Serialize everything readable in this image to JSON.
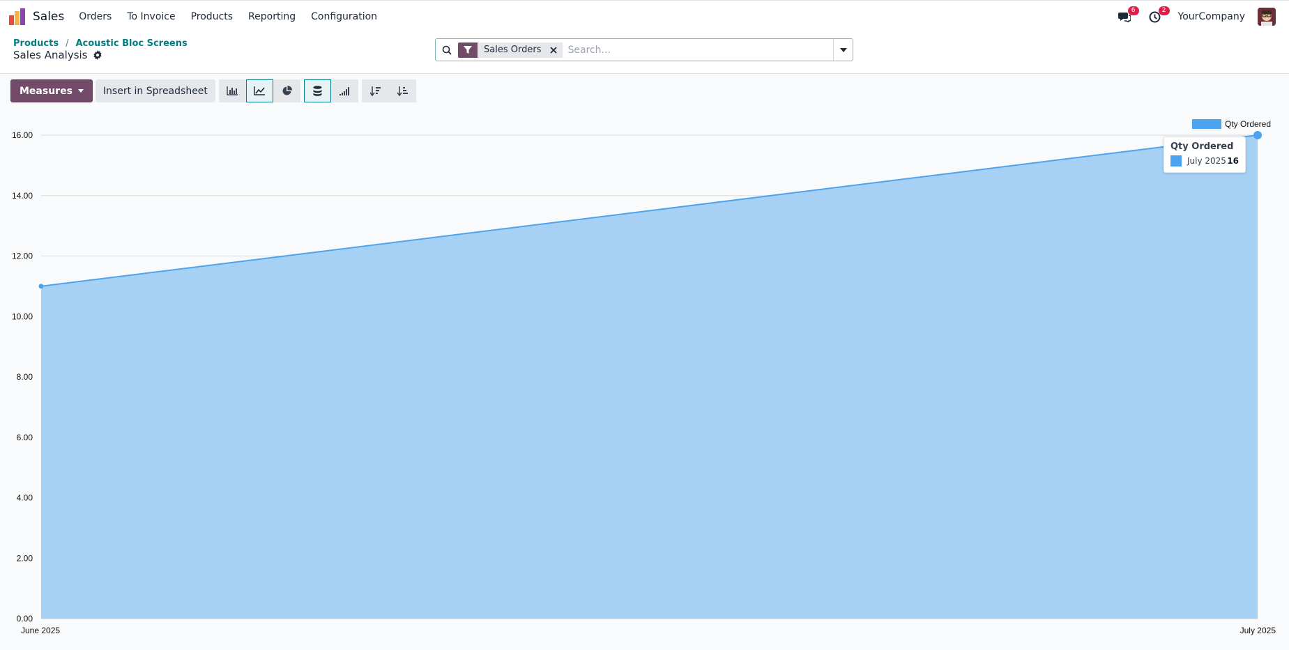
{
  "app": {
    "name": "Sales",
    "menu": [
      "Orders",
      "To Invoice",
      "Products",
      "Reporting",
      "Configuration"
    ],
    "messages_badge": "6",
    "activities_badge": "2",
    "company": "YourCompany"
  },
  "breadcrumb": {
    "items": [
      "Products",
      "Acoustic Bloc Screens"
    ],
    "title": "Sales Analysis"
  },
  "search": {
    "facet": "Sales Orders",
    "placeholder": "Search..."
  },
  "toolbar": {
    "measures_label": "Measures",
    "spreadsheet_label": "Insert in Spreadsheet",
    "active_view": "line-chart",
    "stacked_active": true
  },
  "tooltip": {
    "title": "Qty Ordered",
    "label": "July 2025",
    "value": "16"
  },
  "colors": {
    "brand": "#714b67",
    "link": "#017e84",
    "series_line": "#4ea3ee",
    "series_fill": "#a6d1f5",
    "badge": "#e11d48"
  },
  "chart_data": {
    "type": "area",
    "categories": [
      "June 2025",
      "July 2025"
    ],
    "series": [
      {
        "name": "Qty Ordered",
        "values": [
          11,
          16
        ]
      }
    ],
    "yticks": [
      "0.00",
      "2.00",
      "4.00",
      "6.00",
      "8.00",
      "10.00",
      "12.00",
      "14.00",
      "16.00"
    ],
    "ylim": [
      0,
      16
    ],
    "grid": true,
    "legend": "top-right"
  }
}
